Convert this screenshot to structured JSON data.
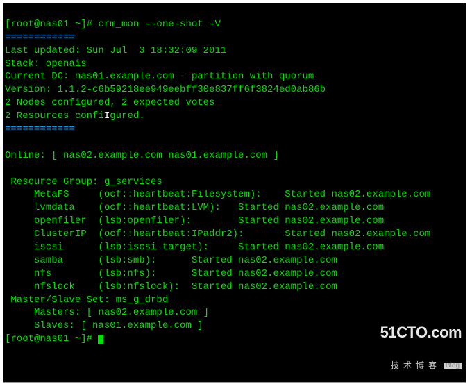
{
  "prompt1": {
    "left": "[root@nas01 ~]# ",
    "cmd": "crm_mon --one-shot -V"
  },
  "divider": "============",
  "status": {
    "last_updated": "Last updated: Sun Jul  3 18:32:09 2011",
    "stack": "Stack: openais",
    "current_dc": "Current DC: nas01.example.com - partition with quorum",
    "version": "Version: 1.1.2-c6b59218ee949eebff30e837ff6f3824ed0ab86b",
    "nodes": "2 Nodes configured, 2 expected votes",
    "resources_a": "2 Resources confi",
    "resources_caret": "I",
    "resources_b": "gured."
  },
  "online": "Online: [ nas02.example.com nas01.example.com ]",
  "group": {
    "header": " Resource Group: g_services",
    "r0": "     MetaFS     (ocf::heartbeat:Filesystem):    Started nas02.example.com",
    "r1": "     lvmdata    (ocf::heartbeat:LVM):   Started nas02.example.com",
    "r2": "     openfiler  (lsb:openfiler):        Started nas02.example.com",
    "r3": "     ClusterIP  (ocf::heartbeat:IPaddr2):       Started nas02.example.com",
    "r4": "     iscsi      (lsb:iscsi-target):     Started nas02.example.com",
    "r5": "     samba      (lsb:smb):      Started nas02.example.com",
    "r6": "     nfs        (lsb:nfs):      Started nas02.example.com",
    "r7": "     nfslock    (lsb:nfslock):  Started nas02.example.com"
  },
  "ms": {
    "header": " Master/Slave Set: ms_g_drbd",
    "masters": "     Masters: [ nas02.example.com ]",
    "slaves": "     Slaves: [ nas01.example.com ]"
  },
  "prompt2": {
    "left": "[root@nas01 ~]# "
  },
  "watermark": {
    "domain": "51CTO.com",
    "tag": "技术博客",
    "blog": "Blog"
  }
}
